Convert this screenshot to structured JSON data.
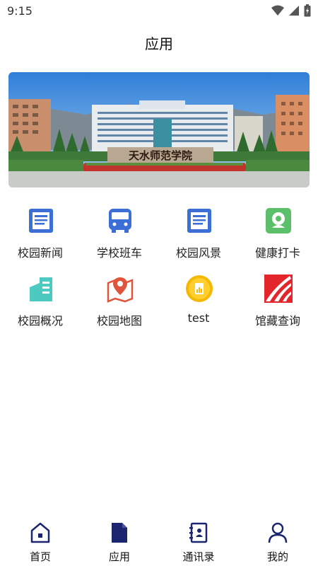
{
  "status_bar": {
    "time": "9:15",
    "icons": [
      "wifi-icon",
      "signal-icon",
      "battery-icon"
    ]
  },
  "header": {
    "title": "应用"
  },
  "banner": {
    "sign_text": "天水师范学院"
  },
  "apps": [
    {
      "label": "校园新闻",
      "icon": "news-document-icon",
      "color": "#3b6fd6"
    },
    {
      "label": "学校班车",
      "icon": "bus-icon",
      "color": "#3b6fd6"
    },
    {
      "label": "校园风景",
      "icon": "landscape-document-icon",
      "color": "#3b6fd6"
    },
    {
      "label": "健康打卡",
      "icon": "health-checkin-icon",
      "color": "#5cc06a"
    },
    {
      "label": "校园概况",
      "icon": "buildings-icon",
      "color": "#4cc9c0"
    },
    {
      "label": "校园地图",
      "icon": "map-pin-icon",
      "color": "#e0543c"
    },
    {
      "label": "test",
      "icon": "chart-coin-icon",
      "color": "#f5b800"
    },
    {
      "label": "馆藏查询",
      "icon": "library-logo-icon",
      "color": "#e3262b"
    }
  ],
  "tab_bar": {
    "items": [
      {
        "label": "首页",
        "icon": "home-icon",
        "active": false
      },
      {
        "label": "应用",
        "icon": "apps-document-icon",
        "active": true
      },
      {
        "label": "通讯录",
        "icon": "contacts-book-icon",
        "active": false
      },
      {
        "label": "我的",
        "icon": "user-icon",
        "active": false
      }
    ],
    "accent_color": "#1c2670"
  }
}
